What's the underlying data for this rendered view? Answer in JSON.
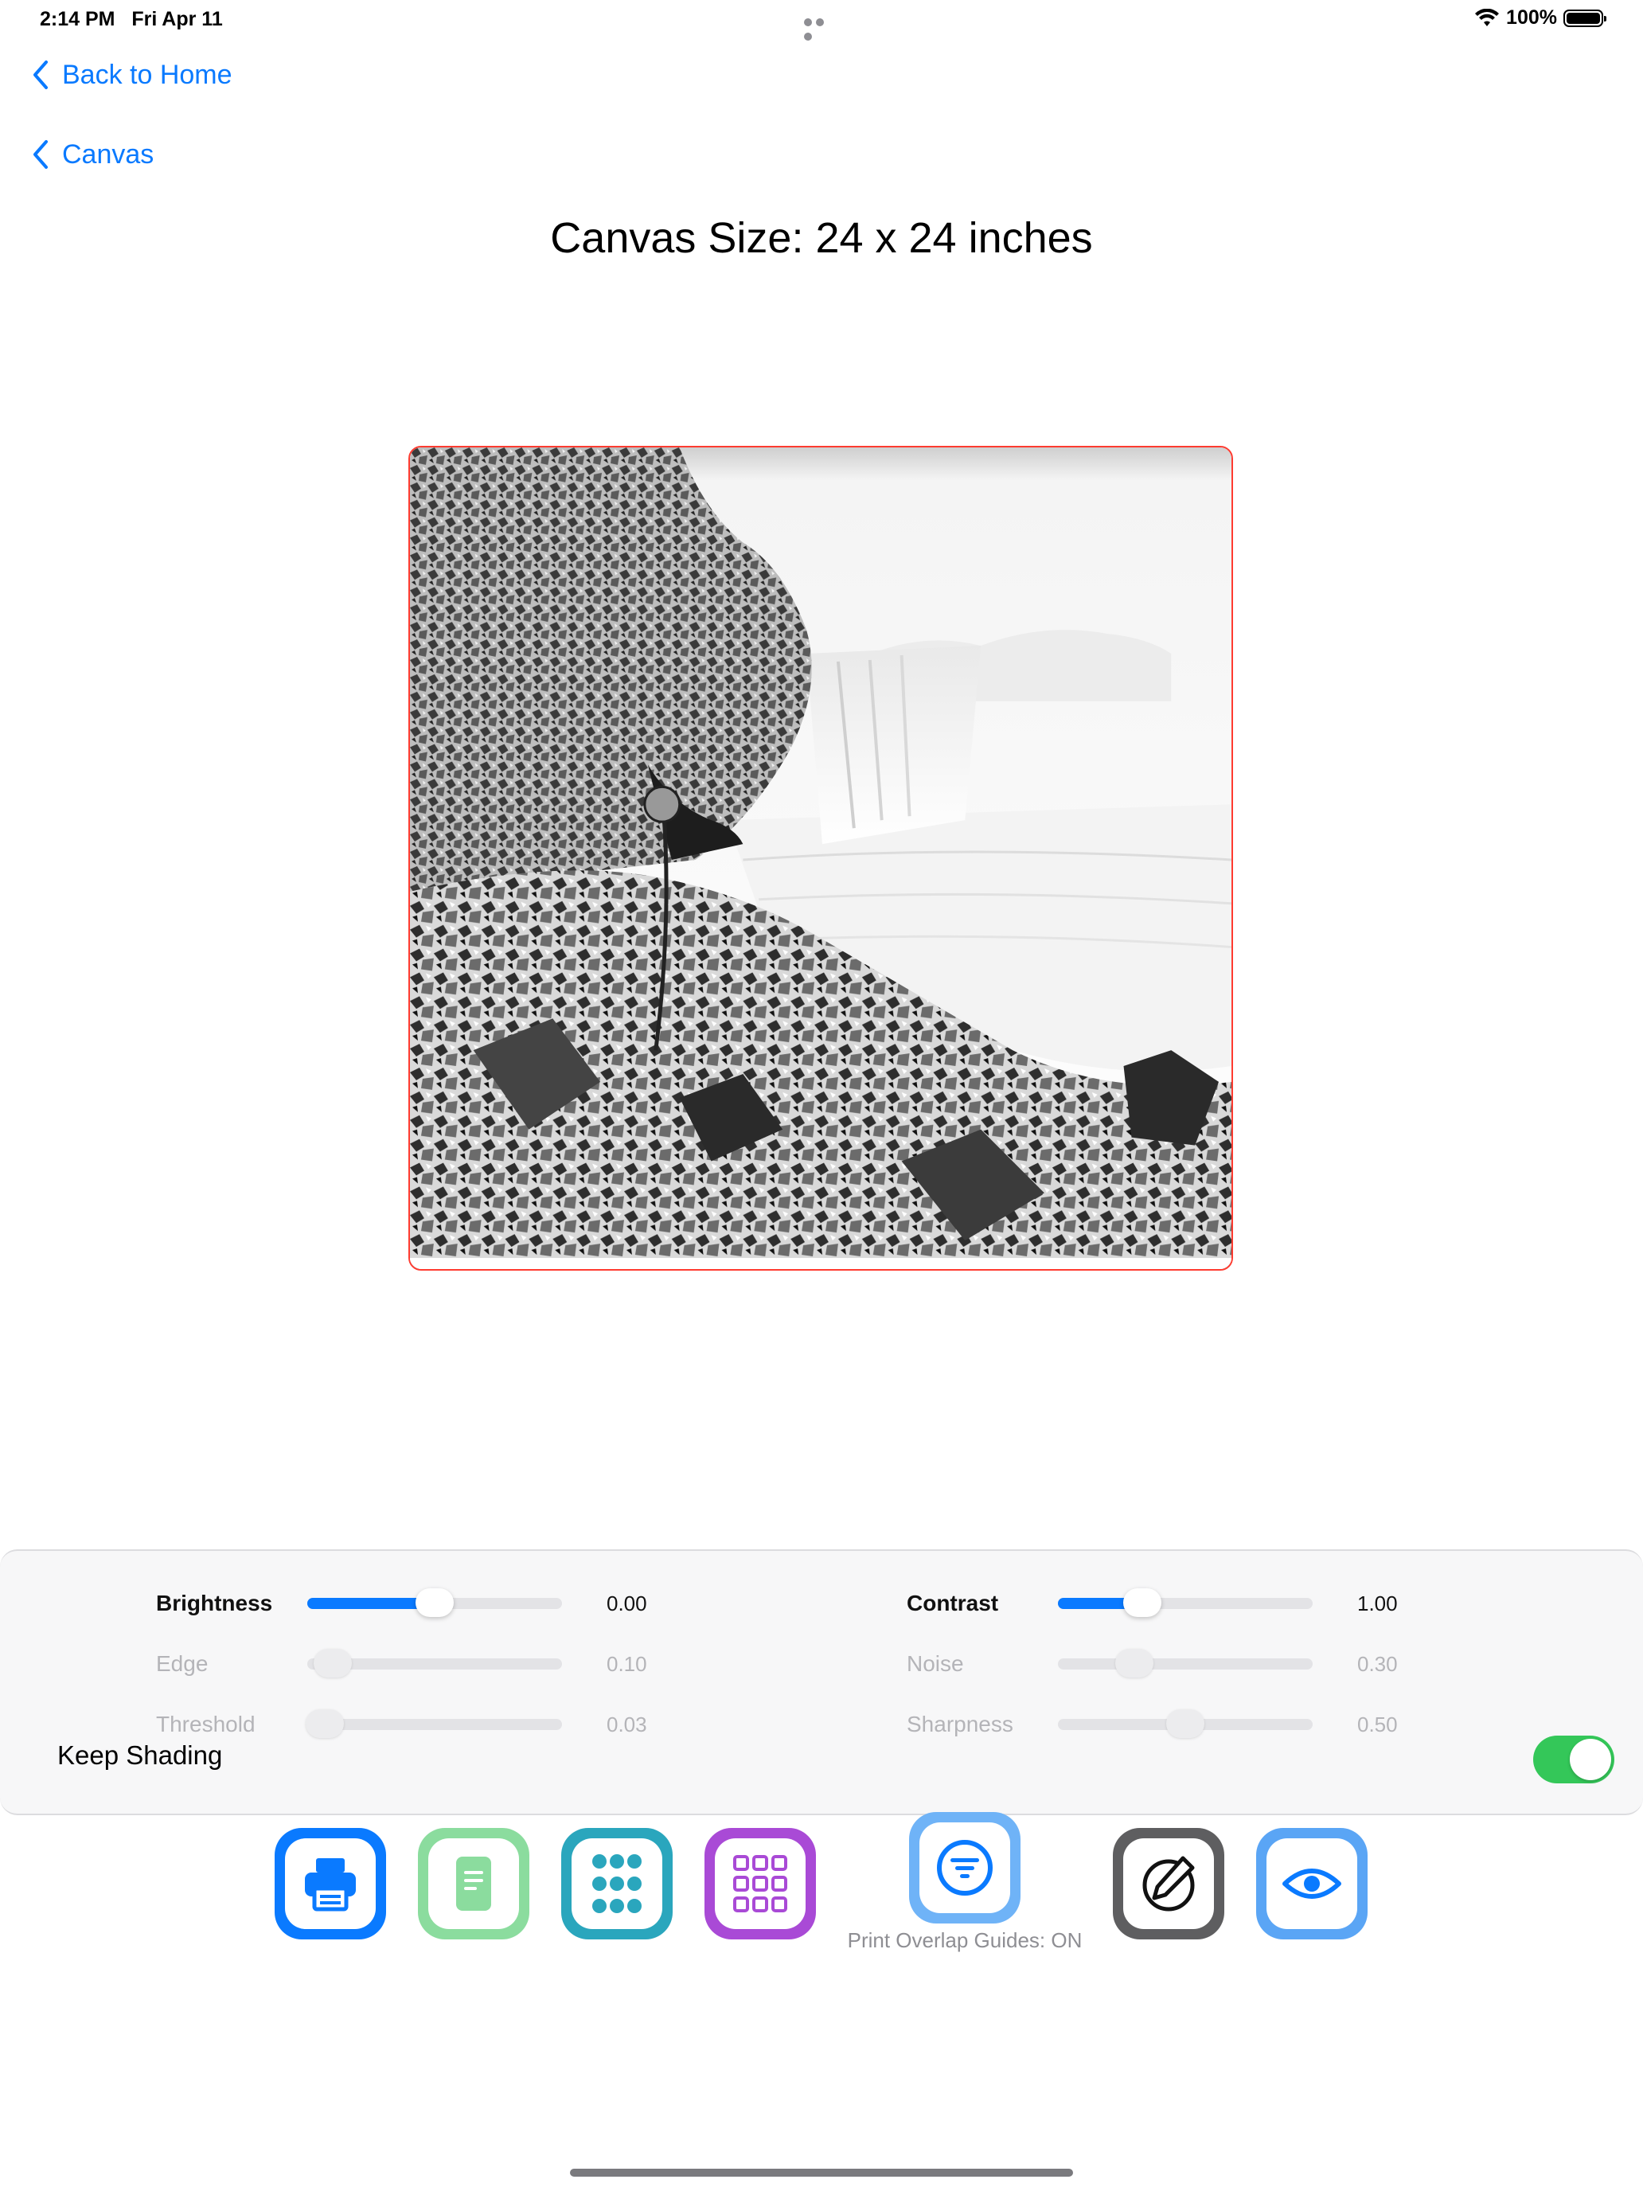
{
  "status_bar": {
    "time": "2:14 PM",
    "date": "Fri Apr 11",
    "battery": "100%",
    "battery_level": 1.0,
    "icons": [
      "wifi-icon",
      "battery-icon",
      "multitasking-dots-icon"
    ]
  },
  "nav": {
    "back_home": "Back to Home",
    "back_canvas": "Canvas",
    "accent": "#0a7aff"
  },
  "page": {
    "title": "Canvas Size: 24 x 24 inches"
  },
  "canvas": {
    "border_color": "#ff3b30",
    "image_description": "sketch-filtered waterfall landscape"
  },
  "controls": {
    "sliders": [
      {
        "label": "Brightness",
        "value": "0.00",
        "level": 0.5,
        "enabled": true
      },
      {
        "label": "Contrast",
        "value": "1.00",
        "level": 0.33,
        "enabled": true
      },
      {
        "label": "Edge",
        "value": "0.10",
        "level": 0.1,
        "enabled": false
      },
      {
        "label": "Noise",
        "value": "0.30",
        "level": 0.3,
        "enabled": false
      },
      {
        "label": "Threshold",
        "value": "0.03",
        "level": 0.03,
        "enabled": false
      },
      {
        "label": "Sharpness",
        "value": "0.50",
        "level": 0.5,
        "enabled": false
      }
    ],
    "keep_shading": {
      "label": "Keep Shading",
      "on": true,
      "color": "#34c759"
    }
  },
  "toolbar": {
    "buttons": [
      {
        "name": "print",
        "icon": "printer-icon",
        "color": "#0a7aff"
      },
      {
        "name": "document",
        "icon": "document-icon",
        "color": "#8bdc9e"
      },
      {
        "name": "dots-grid",
        "icon": "dot-grid-icon",
        "color": "#2aa6bd"
      },
      {
        "name": "tile-grid",
        "icon": "tile-grid-icon",
        "color": "#a94ad6"
      },
      {
        "name": "overlap-guides",
        "icon": "filter-lines-icon",
        "color": "#6fb3f7"
      },
      {
        "name": "pencil",
        "icon": "pencil-circle-icon",
        "color": "#5e5e60"
      },
      {
        "name": "preview",
        "icon": "eye-icon",
        "color": "#5aa5f5"
      }
    ],
    "caption": "Print Overlap Guides: ON"
  }
}
